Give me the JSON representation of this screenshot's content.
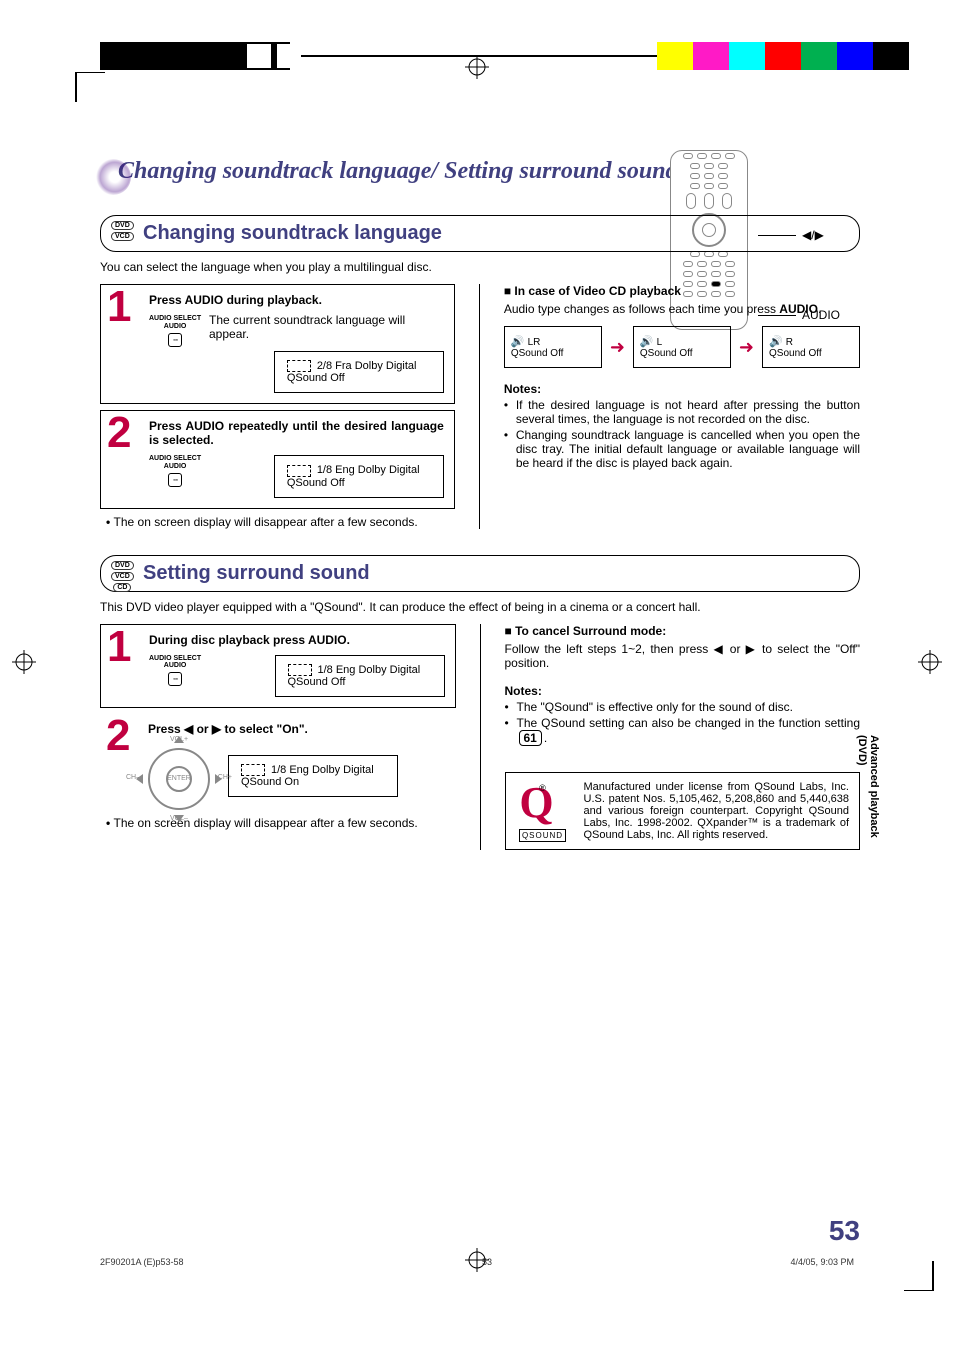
{
  "page_number": "53",
  "side_tab": "Advanced playback (DVD)",
  "title": "Changing soundtrack language/ Setting surround sound",
  "remote_callouts": {
    "nav": "◀/▶",
    "audio": "AUDIO"
  },
  "sec1": {
    "icons": [
      "DVD",
      "VCD"
    ],
    "title": "Changing soundtrack language",
    "intro": "You can select the language when you play a multilingual disc.",
    "step1": {
      "head": "Press AUDIO during playback.",
      "btn_top": "AUDIO SELECT",
      "btn_mid": "AUDIO",
      "body": "The current soundtrack language will appear.",
      "osd_l1": "2/8 Fra Dolby Digital",
      "osd_l2": "QSound Off"
    },
    "step2": {
      "head": "Press AUDIO repeatedly until the desired language is selected.",
      "btn_top": "AUDIO SELECT",
      "btn_mid": "AUDIO",
      "osd_l1": "1/8 Eng Dolby Digital",
      "osd_l2": "QSound Off",
      "note": "The on screen display will disappear after a few seconds."
    },
    "right": {
      "head": "In case of Video CD playback",
      "body_a": "Audio type changes as follows each time you press ",
      "body_b": "AUDIO",
      "body_c": ".",
      "box1_l1": "LR",
      "box1_l2": "QSound Off",
      "box2_l1": "L",
      "box2_l2": "QSound Off",
      "box3_l1": "R",
      "box3_l2": "QSound Off",
      "notes_h": "Notes:",
      "n1": "If the desired language is not heard after pressing the button several times, the language is not recorded on the disc.",
      "n2": "Changing soundtrack language is cancelled when you open the disc tray. The initial default language or available language will be heard if the disc is played back again."
    }
  },
  "sec2": {
    "icons": [
      "DVD",
      "VCD",
      "CD"
    ],
    "title": "Setting surround sound",
    "intro": "This DVD video player equipped with a \"QSound\". It can produce the effect of being in a cinema or a concert hall.",
    "step1": {
      "head": "During disc playback press AUDIO.",
      "btn_top": "AUDIO SELECT",
      "btn_mid": "AUDIO",
      "osd_l1": "1/8 Eng Dolby Digital",
      "osd_l2": "QSound Off"
    },
    "step2": {
      "head": "Press ◀ or ▶ to select \"On\".",
      "enter": "ENTER",
      "osd_l1": "1/8 Eng Dolby Digital",
      "osd_l2": "QSound On",
      "note": "The on screen display will disappear after a few seconds."
    },
    "right": {
      "cancel_h": "To cancel Surround mode",
      "cancel_b": "Follow the left steps 1~2, then press ◀ or ▶ to select the \"Off\" position.",
      "notes_h": "Notes:",
      "n1": "The \"QSound\" is effective only for the sound of disc.",
      "n2_a": "The QSound setting can also be changed in the function setting ",
      "n2_ref": "61",
      "n2_b": ".",
      "qsound_lbl": "QSOUND",
      "qtext": "Manufactured under license from QSound Labs, Inc. U.S. patent Nos. 5,105,462, 5,208,860 and 5,440,638 and various foreign counterpart. Copyright QSound Labs, Inc. 1998-2002. QXpander™ is a trademark of QSound Labs, Inc. All rights reserved."
    }
  },
  "footer": {
    "left": "2F90201A (E)p53-58",
    "mid": "53",
    "right": "4/4/05, 9:03 PM"
  }
}
